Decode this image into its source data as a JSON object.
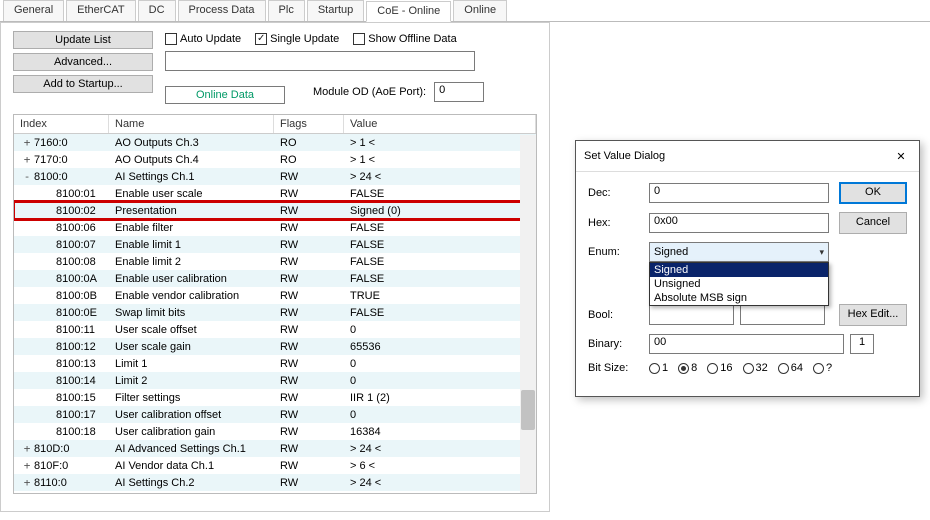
{
  "tabs": [
    "General",
    "EtherCAT",
    "DC",
    "Process Data",
    "Plc",
    "Startup",
    "CoE - Online",
    "Online"
  ],
  "active_tab": 6,
  "buttons": {
    "update_list": "Update List",
    "advanced": "Advanced...",
    "add_startup": "Add to Startup..."
  },
  "checks": {
    "auto": "Auto Update",
    "single": "Single Update",
    "offline": "Show Offline Data"
  },
  "online_data": "Online Data",
  "module_label": "Module OD (AoE Port):",
  "module_val": "0",
  "cols": {
    "index": "Index",
    "name": "Name",
    "flags": "Flags",
    "value": "Value"
  },
  "rows": [
    {
      "exp": "+",
      "lvl": 1,
      "idx": "7160:0",
      "name": "AO Outputs Ch.3",
      "flags": "RO",
      "val": "> 1 <"
    },
    {
      "exp": "+",
      "lvl": 1,
      "idx": "7170:0",
      "name": "AO Outputs Ch.4",
      "flags": "RO",
      "val": "> 1 <"
    },
    {
      "exp": "-",
      "lvl": 1,
      "idx": "8100:0",
      "name": "AI Settings Ch.1",
      "flags": "RW",
      "val": "> 24 <"
    },
    {
      "exp": "",
      "lvl": 2,
      "idx": "8100:01",
      "name": "Enable user scale",
      "flags": "RW",
      "val": "FALSE"
    },
    {
      "exp": "",
      "lvl": 2,
      "idx": "8100:02",
      "name": "Presentation",
      "flags": "RW",
      "val": "Signed (0)",
      "hl": true
    },
    {
      "exp": "",
      "lvl": 2,
      "idx": "8100:06",
      "name": "Enable filter",
      "flags": "RW",
      "val": "FALSE"
    },
    {
      "exp": "",
      "lvl": 2,
      "idx": "8100:07",
      "name": "Enable limit 1",
      "flags": "RW",
      "val": "FALSE"
    },
    {
      "exp": "",
      "lvl": 2,
      "idx": "8100:08",
      "name": "Enable limit 2",
      "flags": "RW",
      "val": "FALSE"
    },
    {
      "exp": "",
      "lvl": 2,
      "idx": "8100:0A",
      "name": "Enable user calibration",
      "flags": "RW",
      "val": "FALSE"
    },
    {
      "exp": "",
      "lvl": 2,
      "idx": "8100:0B",
      "name": "Enable vendor calibration",
      "flags": "RW",
      "val": "TRUE"
    },
    {
      "exp": "",
      "lvl": 2,
      "idx": "8100:0E",
      "name": "Swap limit bits",
      "flags": "RW",
      "val": "FALSE"
    },
    {
      "exp": "",
      "lvl": 2,
      "idx": "8100:11",
      "name": "User scale offset",
      "flags": "RW",
      "val": "0"
    },
    {
      "exp": "",
      "lvl": 2,
      "idx": "8100:12",
      "name": "User scale gain",
      "flags": "RW",
      "val": "65536"
    },
    {
      "exp": "",
      "lvl": 2,
      "idx": "8100:13",
      "name": "Limit 1",
      "flags": "RW",
      "val": "0"
    },
    {
      "exp": "",
      "lvl": 2,
      "idx": "8100:14",
      "name": "Limit 2",
      "flags": "RW",
      "val": "0"
    },
    {
      "exp": "",
      "lvl": 2,
      "idx": "8100:15",
      "name": "Filter settings",
      "flags": "RW",
      "val": "IIR 1 (2)"
    },
    {
      "exp": "",
      "lvl": 2,
      "idx": "8100:17",
      "name": "User calibration offset",
      "flags": "RW",
      "val": "0"
    },
    {
      "exp": "",
      "lvl": 2,
      "idx": "8100:18",
      "name": "User calibration gain",
      "flags": "RW",
      "val": "16384"
    },
    {
      "exp": "+",
      "lvl": 1,
      "idx": "810D:0",
      "name": "AI Advanced Settings Ch.1",
      "flags": "RW",
      "val": "> 24 <"
    },
    {
      "exp": "+",
      "lvl": 1,
      "idx": "810F:0",
      "name": "AI Vendor data Ch.1",
      "flags": "RW",
      "val": "> 6 <"
    },
    {
      "exp": "+",
      "lvl": 1,
      "idx": "8110:0",
      "name": "AI Settings Ch.2",
      "flags": "RW",
      "val": "> 24 <"
    }
  ],
  "dialog": {
    "title": "Set Value Dialog",
    "dec_l": "Dec:",
    "dec_v": "0",
    "hex_l": "Hex:",
    "hex_v": "0x00",
    "enum_l": "Enum:",
    "enum_v": "Signed",
    "enum_opts": [
      "Signed",
      "Unsigned",
      "Absolute MSB sign"
    ],
    "bool_l": "Bool:",
    "hexedit": "Hex Edit...",
    "binary_l": "Binary:",
    "binary_v": "00",
    "binary_n": "1",
    "bits_l": "Bit Size:",
    "bits": [
      "1",
      "8",
      "16",
      "32",
      "64",
      "?"
    ],
    "bits_sel": "8",
    "ok": "OK",
    "cancel": "Cancel"
  }
}
